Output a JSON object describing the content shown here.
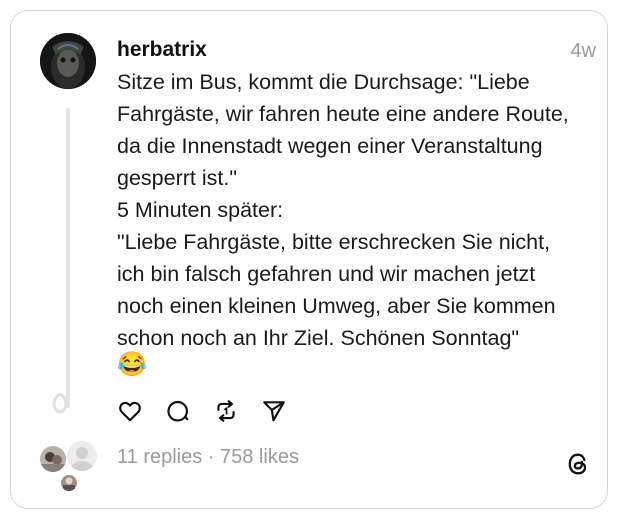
{
  "post": {
    "username": "herbatrix",
    "time": "4w",
    "text": "Sitze im Bus, kommt die Durchsage: \"Liebe\nFahrgäste, wir fahren heute eine andere Route,\nda die Innenstadt wegen einer Veranstaltung\ngesperrt ist.\"\n5 Minuten später:\n\"Liebe Fahrgäste, bitte erschrecken Sie nicht,\nich bin falsch gefahren und wir machen jetzt\nnoch einen kleinen Umweg, aber Sie kommen\nschon noch an Ihr Ziel. Schönen Sonntag\"",
    "emoji": "😂"
  },
  "actions": {
    "like_icon": "heart-icon",
    "comment_icon": "comment-icon",
    "repost_icon": "repost-icon",
    "share_icon": "share-icon"
  },
  "stats": {
    "text": "11 replies · 758 likes"
  },
  "colors": {
    "text": "#1a1a1a",
    "muted": "#9a9a9a",
    "border": "#d7d7d7"
  }
}
